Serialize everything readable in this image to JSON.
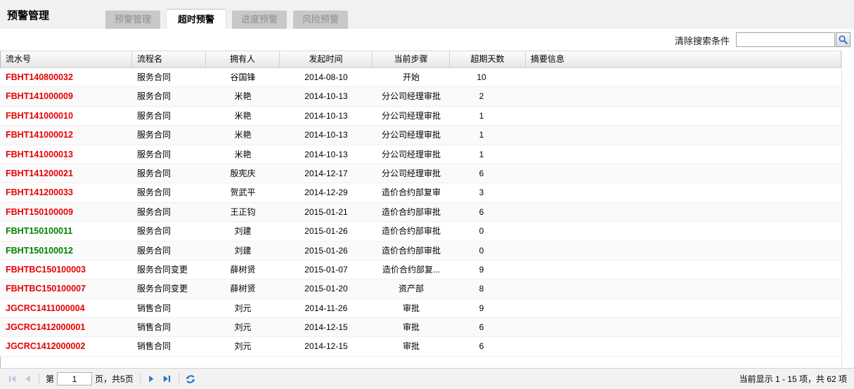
{
  "header": {
    "title": "预警管理"
  },
  "tabs": [
    {
      "label": "预警管理",
      "active": false
    },
    {
      "label": "超时预警",
      "active": true
    },
    {
      "label": "进度预警",
      "active": false
    },
    {
      "label": "风险预警",
      "active": false
    }
  ],
  "toolbar": {
    "clear_search_label": "清除搜索条件",
    "search_value": "",
    "search_icon": "magnifier-icon"
  },
  "table": {
    "columns": [
      {
        "label": "流水号"
      },
      {
        "label": "流程名"
      },
      {
        "label": "拥有人"
      },
      {
        "label": "发起时间"
      },
      {
        "label": "当前步骤"
      },
      {
        "label": "超期天数"
      },
      {
        "label": "摘要信息"
      }
    ],
    "rows": [
      {
        "id": "FBHT140800032",
        "id_color": "#e80000",
        "process": "服务合同",
        "owner": "谷国锋",
        "start_date": "2014-08-10",
        "step": "开始",
        "overdue_days": "10",
        "summary": ""
      },
      {
        "id": "FBHT141000009",
        "id_color": "#e80000",
        "process": "服务合同",
        "owner": "米艳",
        "start_date": "2014-10-13",
        "step": "分公司经理审批",
        "overdue_days": "2",
        "summary": ""
      },
      {
        "id": "FBHT141000010",
        "id_color": "#e80000",
        "process": "服务合同",
        "owner": "米艳",
        "start_date": "2014-10-13",
        "step": "分公司经理审批",
        "overdue_days": "1",
        "summary": ""
      },
      {
        "id": "FBHT141000012",
        "id_color": "#e80000",
        "process": "服务合同",
        "owner": "米艳",
        "start_date": "2014-10-13",
        "step": "分公司经理审批",
        "overdue_days": "1",
        "summary": ""
      },
      {
        "id": "FBHT141000013",
        "id_color": "#e80000",
        "process": "服务合同",
        "owner": "米艳",
        "start_date": "2014-10-13",
        "step": "分公司经理审批",
        "overdue_days": "1",
        "summary": ""
      },
      {
        "id": "FBHT141200021",
        "id_color": "#e80000",
        "process": "服务合同",
        "owner": "殷宪庆",
        "start_date": "2014-12-17",
        "step": "分公司经理审批",
        "overdue_days": "6",
        "summary": ""
      },
      {
        "id": "FBHT141200033",
        "id_color": "#e80000",
        "process": "服务合同",
        "owner": "贺武平",
        "start_date": "2014-12-29",
        "step": "造价合约部复审",
        "overdue_days": "3",
        "summary": ""
      },
      {
        "id": "FBHT150100009",
        "id_color": "#e80000",
        "process": "服务合同",
        "owner": "王正钧",
        "start_date": "2015-01-21",
        "step": "造价合约部审批",
        "overdue_days": "6",
        "summary": ""
      },
      {
        "id": "FBHT150100011",
        "id_color": "#008000",
        "process": "服务合同",
        "owner": "刘建",
        "start_date": "2015-01-26",
        "step": "造价合约部审批",
        "overdue_days": "0",
        "summary": ""
      },
      {
        "id": "FBHT150100012",
        "id_color": "#008000",
        "process": "服务合同",
        "owner": "刘建",
        "start_date": "2015-01-26",
        "step": "造价合约部审批",
        "overdue_days": "0",
        "summary": ""
      },
      {
        "id": "FBHTBC150100003",
        "id_color": "#e80000",
        "process": "服务合同变更",
        "owner": "薛树贤",
        "start_date": "2015-01-07",
        "step": "造价合约部复...",
        "overdue_days": "9",
        "summary": ""
      },
      {
        "id": "FBHTBC150100007",
        "id_color": "#e80000",
        "process": "服务合同变更",
        "owner": "薛树贤",
        "start_date": "2015-01-20",
        "step": "资产部",
        "overdue_days": "8",
        "summary": ""
      },
      {
        "id": "JGCRC1411000004",
        "id_color": "#e80000",
        "process": "销售合同",
        "owner": "刘元",
        "start_date": "2014-11-26",
        "step": "审批",
        "overdue_days": "9",
        "summary": ""
      },
      {
        "id": "JGCRC1412000001",
        "id_color": "#e80000",
        "process": "销售合同",
        "owner": "刘元",
        "start_date": "2014-12-15",
        "step": "审批",
        "overdue_days": "6",
        "summary": ""
      },
      {
        "id": "JGCRC1412000002",
        "id_color": "#e80000",
        "process": "销售合同",
        "owner": "刘元",
        "start_date": "2014-12-15",
        "step": "审批",
        "overdue_days": "6",
        "summary": ""
      }
    ]
  },
  "pagination": {
    "first_icon": "first-page-icon",
    "prev_icon": "prev-page-icon",
    "page_prefix": "第",
    "current_page": "1",
    "page_suffix": "页，共5页",
    "next_icon": "next-page-icon",
    "last_icon": "last-page-icon",
    "refresh_icon": "refresh-icon",
    "display_info": "当前显示 1 - 15 项，共 62 项"
  },
  "colors": {
    "overdue_red": "#e80000",
    "ok_green": "#008000",
    "icon_blue": "#2e75c6",
    "icon_disabled": "#b7c8da",
    "inactive_tab_bg": "#c8c8c8"
  }
}
